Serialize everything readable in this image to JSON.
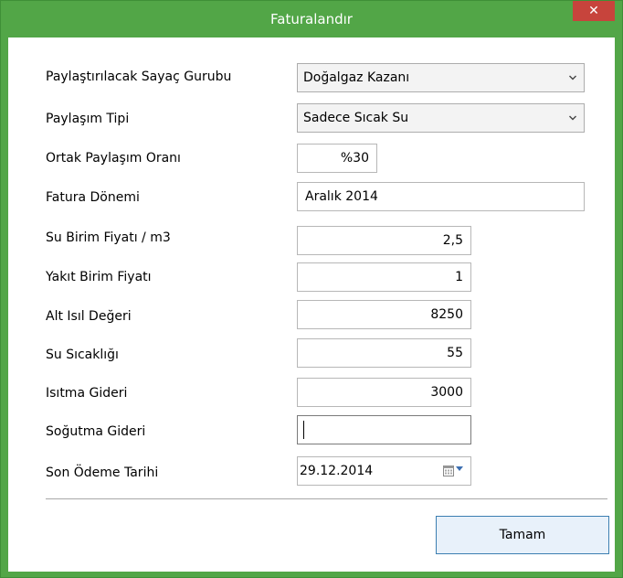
{
  "window": {
    "title": "Faturalandır",
    "close_glyph": "✕"
  },
  "form": {
    "sayac_gurubu": {
      "label": "Paylaştırılacak Sayaç Gurubu",
      "value": "Doğalgaz Kazanı"
    },
    "paylasim_tipi": {
      "label": "Paylaşım Tipi",
      "value": "Sadece Sıcak Su"
    },
    "ortak_oran": {
      "label": "Ortak Paylaşım Oranı",
      "value": "%30"
    },
    "fatura_donemi": {
      "label": "Fatura Dönemi",
      "value": "Aralık 2014"
    },
    "su_birim_fiyati": {
      "label": "Su Birim Fiyatı / m3",
      "value": "2,5"
    },
    "yakit_birim_fiyati": {
      "label": "Yakıt Birim Fiyatı",
      "value": "1"
    },
    "alt_isil_degeri": {
      "label": "Alt Isıl Değeri",
      "value": "8250"
    },
    "su_sicakligi": {
      "label": "Su Sıcaklığı",
      "value": "55"
    },
    "isitma_gideri": {
      "label": "Isıtma Gideri",
      "value": "3000"
    },
    "sogutma_gideri": {
      "label": "Soğutma Gideri",
      "value": ""
    },
    "son_odeme_tarihi": {
      "label": "Son Ödeme Tarihi",
      "value": "29.12.2014"
    }
  },
  "buttons": {
    "ok_label": "Tamam"
  },
  "colors": {
    "titlebar": "#52a647",
    "close": "#c7443c",
    "ok_border": "#3c7fb1"
  }
}
